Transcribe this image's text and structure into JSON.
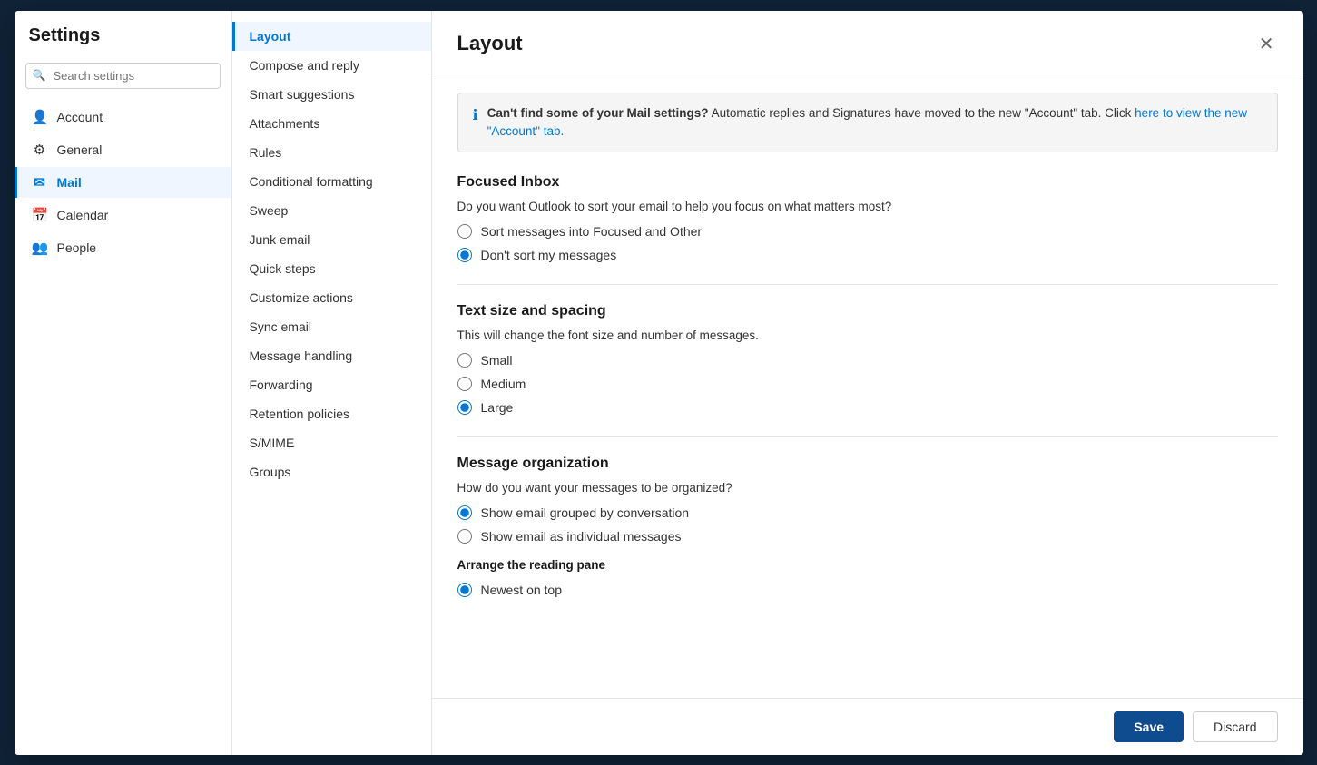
{
  "modal": {
    "title": "Layout",
    "close_label": "✕"
  },
  "sidebar": {
    "title": "Settings",
    "search_placeholder": "Search settings",
    "nav_items": [
      {
        "id": "account",
        "label": "Account",
        "icon": "👤"
      },
      {
        "id": "general",
        "label": "General",
        "icon": "⚙"
      },
      {
        "id": "mail",
        "label": "Mail",
        "icon": "✉",
        "active": true
      },
      {
        "id": "calendar",
        "label": "Calendar",
        "icon": "📅"
      },
      {
        "id": "people",
        "label": "People",
        "icon": "👥"
      }
    ]
  },
  "submenu": {
    "items": [
      {
        "id": "layout",
        "label": "Layout",
        "active": true
      },
      {
        "id": "compose-reply",
        "label": "Compose and reply"
      },
      {
        "id": "smart-suggestions",
        "label": "Smart suggestions"
      },
      {
        "id": "attachments",
        "label": "Attachments"
      },
      {
        "id": "rules",
        "label": "Rules"
      },
      {
        "id": "conditional-formatting",
        "label": "Conditional formatting"
      },
      {
        "id": "sweep",
        "label": "Sweep"
      },
      {
        "id": "junk-email",
        "label": "Junk email"
      },
      {
        "id": "quick-steps",
        "label": "Quick steps"
      },
      {
        "id": "customize-actions",
        "label": "Customize actions"
      },
      {
        "id": "sync-email",
        "label": "Sync email"
      },
      {
        "id": "message-handling",
        "label": "Message handling"
      },
      {
        "id": "forwarding",
        "label": "Forwarding"
      },
      {
        "id": "retention-policies",
        "label": "Retention policies"
      },
      {
        "id": "smime",
        "label": "S/MIME"
      },
      {
        "id": "groups",
        "label": "Groups"
      }
    ]
  },
  "main": {
    "info_banner": {
      "icon": "ℹ",
      "text_bold": "Can't find some of your Mail settings?",
      "text_normal": " Automatic replies and Signatures have moved to the new \"Account\" tab. Click ",
      "link_text": "here to view the new \"Account\" tab.",
      "link_href": "#"
    },
    "sections": [
      {
        "id": "focused-inbox",
        "title": "Focused Inbox",
        "description": "Do you want Outlook to sort your email to help you focus on what matters most?",
        "options": [
          {
            "id": "sort-focused",
            "label": "Sort messages into Focused and Other",
            "checked": false
          },
          {
            "id": "dont-sort",
            "label": "Don't sort my messages",
            "checked": true
          }
        ]
      },
      {
        "id": "text-size-spacing",
        "title": "Text size and spacing",
        "description": "This will change the font size and number of messages.",
        "options": [
          {
            "id": "small",
            "label": "Small",
            "checked": false
          },
          {
            "id": "medium",
            "label": "Medium",
            "checked": false
          },
          {
            "id": "large",
            "label": "Large",
            "checked": true
          }
        ]
      },
      {
        "id": "message-organization",
        "title": "Message organization",
        "description": "How do you want your messages to be organized?",
        "options": [
          {
            "id": "grouped-conversation",
            "label": "Show email grouped by conversation",
            "checked": true
          },
          {
            "id": "individual-messages",
            "label": "Show email as individual messages",
            "checked": false
          }
        ],
        "sub_label": "Arrange the reading pane",
        "sub_options": [
          {
            "id": "newest-top",
            "label": "Newest on top",
            "checked": true
          }
        ]
      }
    ]
  },
  "footer": {
    "save_label": "Save",
    "discard_label": "Discard"
  }
}
